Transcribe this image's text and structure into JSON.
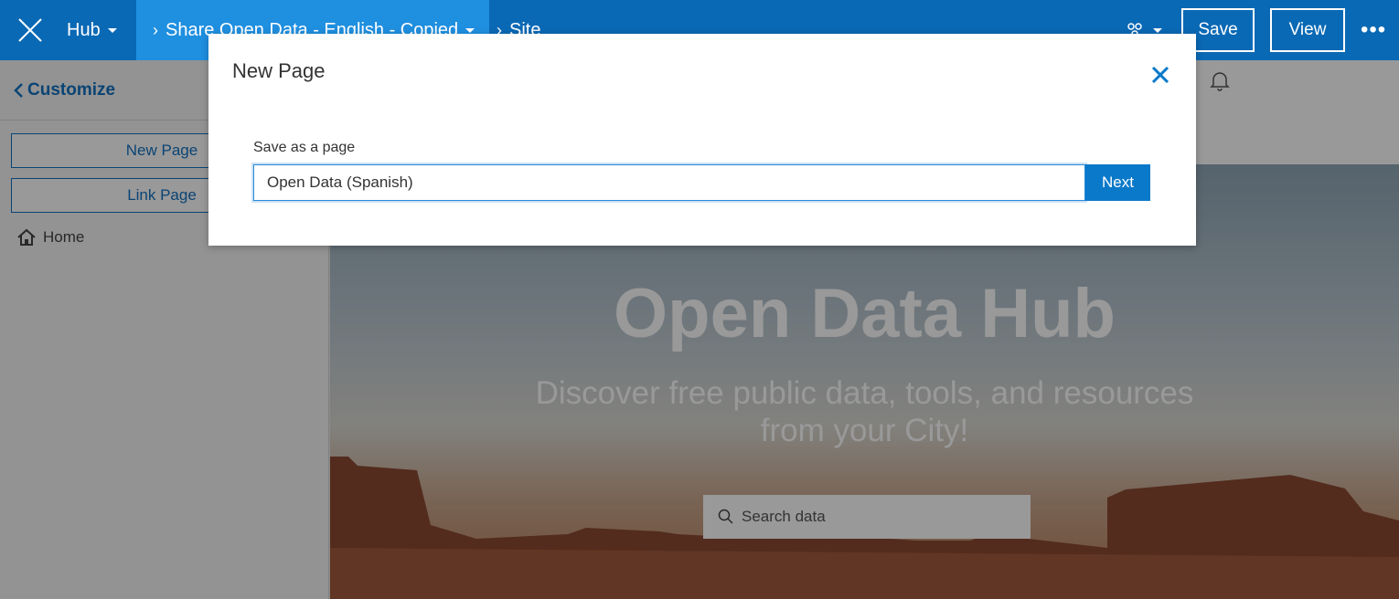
{
  "topbar": {
    "hub_label": "Hub",
    "crumb_label": "Share Open Data - English - Copied",
    "site_label": "Site",
    "save_label": "Save",
    "view_label": "View",
    "more_label": "•••",
    "colors": {
      "bar": "#0a69b5",
      "crumb": "#1f8fe0"
    }
  },
  "left_panel": {
    "customize_label": "Customize",
    "new_page_label": "New Page",
    "link_page_label": "Link Page",
    "home_label": "Home"
  },
  "preview": {
    "title": "Open Data Hub",
    "subtitle": "Discover free public data, tools, and resources from your City!",
    "search_placeholder": "Search data"
  },
  "modal": {
    "title": "New Page",
    "field_label": "Save as a page",
    "field_value": "Open Data (Spanish)",
    "next_label": "Next",
    "accent": "#0a79c9"
  }
}
